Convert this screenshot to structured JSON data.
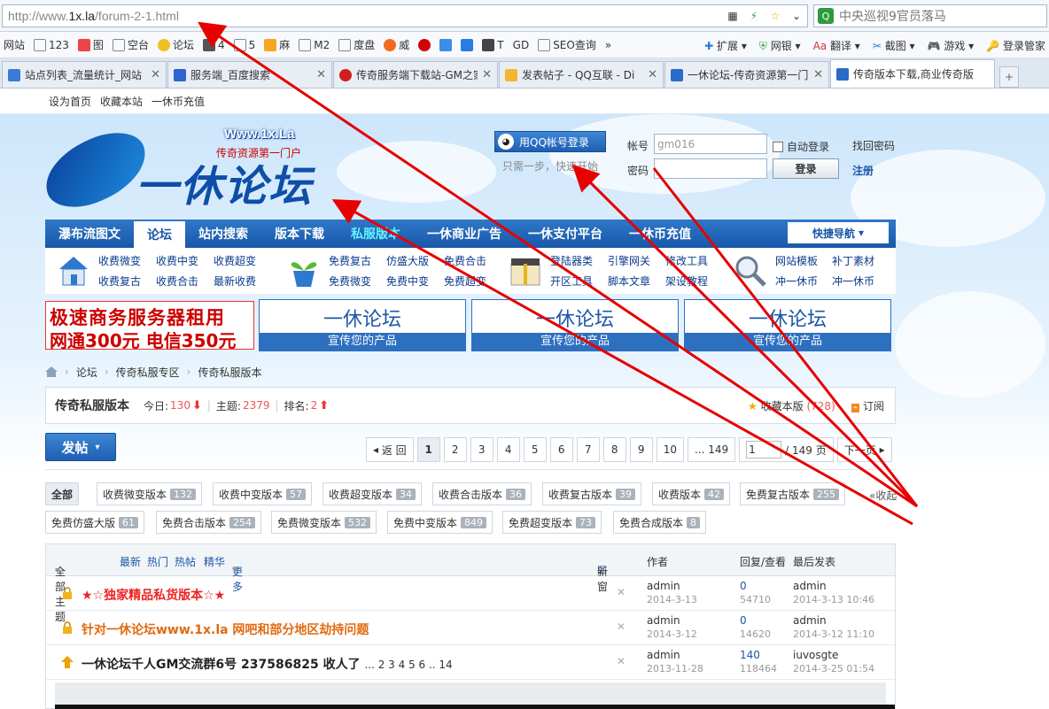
{
  "browser": {
    "url_prefix": "http://www.",
    "url_domain": "1x.la",
    "url_path": "/forum-2-1.html",
    "search_placeholder": "中央巡视9官员落马"
  },
  "bookmarks": {
    "items": [
      "网站",
      "123",
      "图",
      "空台",
      "论坛",
      "4",
      "5",
      "麻",
      "M2",
      "度盘",
      "威",
      "",
      "",
      "",
      "",
      "T",
      "GD",
      "SEO查询"
    ],
    "more": "»",
    "right": [
      "扩展",
      "网银",
      "翻译",
      "截图",
      "游戏",
      "登录管家"
    ]
  },
  "tabs": [
    {
      "title": "站点列表_流量统计_网站",
      "color": "#3a7bd5"
    },
    {
      "title": "服务端_百度搜索",
      "color": "#2f63d0"
    },
    {
      "title": "传奇服务端下载站-GM之家",
      "color": "#d01f1f"
    },
    {
      "title": "发表帖子 - QQ互联 - Di",
      "color": "#f2b632"
    },
    {
      "title": "一休论坛-传奇资源第一门",
      "color": "#2a6cc8"
    },
    {
      "title": "传奇版本下载,商业传奇版",
      "color": "#2a6cc8"
    }
  ],
  "toplinks": [
    "设为首页",
    "收藏本站",
    "一休币充值"
  ],
  "logo": {
    "url": "Www.1x.La",
    "slogan": "传奇资源第一门户",
    "text": "一休论坛"
  },
  "login": {
    "qq_label": "用QQ帐号登录",
    "qq_tip": "只需一步，快速开始",
    "account_label": "帐号",
    "account_value": "gm016",
    "password_label": "密码",
    "remember_label": "自动登录",
    "submit_label": "登录",
    "find_password": "找回密码",
    "register": "注册"
  },
  "nav": {
    "items": [
      "瀑布流图文",
      "论坛",
      "站内搜索",
      "版本下载",
      "私服版本",
      "一休商业广告",
      "一休支付平台",
      "一休币充值"
    ],
    "quick": "快捷导航"
  },
  "sublinks": {
    "group1": [
      "收费微变",
      "收费中变",
      "收费超变",
      "收费复古",
      "收费合击",
      "最新收费"
    ],
    "group2": [
      "免费复古",
      "仿盛大版",
      "免费合击",
      "免费微变",
      "免费中变",
      "免费超变"
    ],
    "group3": [
      "登陆器类",
      "引擎网关",
      "修改工具",
      "开区工具",
      "脚本文章",
      "架设教程"
    ],
    "group4": [
      "网站模板",
      "补丁素材",
      "冲一休币",
      "冲一休币"
    ]
  },
  "ads": {
    "main_line1": "极速商务服务器租用",
    "main_line2": "网通300元 电信350元",
    "box_title": "一休论坛",
    "box_sub": "宣传您的产品"
  },
  "breadcrumb": [
    "论坛",
    "传奇私服专区",
    "传奇私服版本"
  ],
  "forum": {
    "title": "传奇私服版本",
    "today_label": "今日:",
    "today": "130",
    "threads_label": "主题:",
    "threads": "2379",
    "rank_label": "排名:",
    "rank": "2",
    "fav_label": "收藏本版",
    "fav_count": "(728)",
    "subscribe": "订阅"
  },
  "post_button": "发帖",
  "pager": {
    "back": "返 回",
    "pages": [
      "1",
      "2",
      "3",
      "4",
      "5",
      "6",
      "7",
      "8",
      "9",
      "10",
      "... 149"
    ],
    "input_value": "1",
    "total": "/ 149 页",
    "next": "下一页"
  },
  "types": {
    "row1": [
      {
        "label": "全部",
        "count": ""
      },
      {
        "label": "收费微变版本",
        "count": "132"
      },
      {
        "label": "收费中变版本",
        "count": "57"
      },
      {
        "label": "收费超变版本",
        "count": "34"
      },
      {
        "label": "收费合击版本",
        "count": "36"
      },
      {
        "label": "收费复古版本",
        "count": "39"
      },
      {
        "label": "收费版本",
        "count": "42"
      },
      {
        "label": "免费复古版本",
        "count": "255"
      }
    ],
    "collapse": "收起",
    "row2": [
      {
        "label": "免费仿盛大版",
        "count": "61"
      },
      {
        "label": "免费合击版本",
        "count": "254"
      },
      {
        "label": "免费微变版本",
        "count": "532"
      },
      {
        "label": "免费中变版本",
        "count": "849"
      },
      {
        "label": "免费超变版本",
        "count": "73"
      },
      {
        "label": "免费合成版本",
        "count": "8"
      }
    ]
  },
  "list_header": {
    "all": "全部主题",
    "filters": [
      "最新",
      "热门",
      "热帖",
      "精华",
      "更多"
    ],
    "new_window": "新窗",
    "author": "作者",
    "replies": "回复/查看",
    "last": "最后发表"
  },
  "threads": [
    {
      "title": "★☆独家精品私货版本☆★",
      "color": "#e22",
      "author": "admin",
      "date": "2014-3-13",
      "replies": "0",
      "views": "54710",
      "last_user": "admin",
      "last_time": "2014-3-13 10:46"
    },
    {
      "title": "针对一休论坛www.1x.la 网吧和部分地区劫持问题",
      "color": "#e06a10",
      "author": "admin",
      "date": "2014-3-12",
      "replies": "0",
      "views": "14620",
      "last_user": "admin",
      "last_time": "2014-3-12 11:10"
    },
    {
      "title": "一休论坛千人GM交流群6号 237586825 收人了",
      "color": "#222",
      "pages": "... 2 3 4 5 6 .. 14",
      "author": "admin",
      "date": "2013-11-28",
      "replies": "140",
      "views": "118464",
      "last_user": "iuvosgte",
      "last_time": "2014-3-25 01:54"
    }
  ],
  "colors": {
    "brand_blue": "#1857a8",
    "annotation_red": "#e60000"
  }
}
